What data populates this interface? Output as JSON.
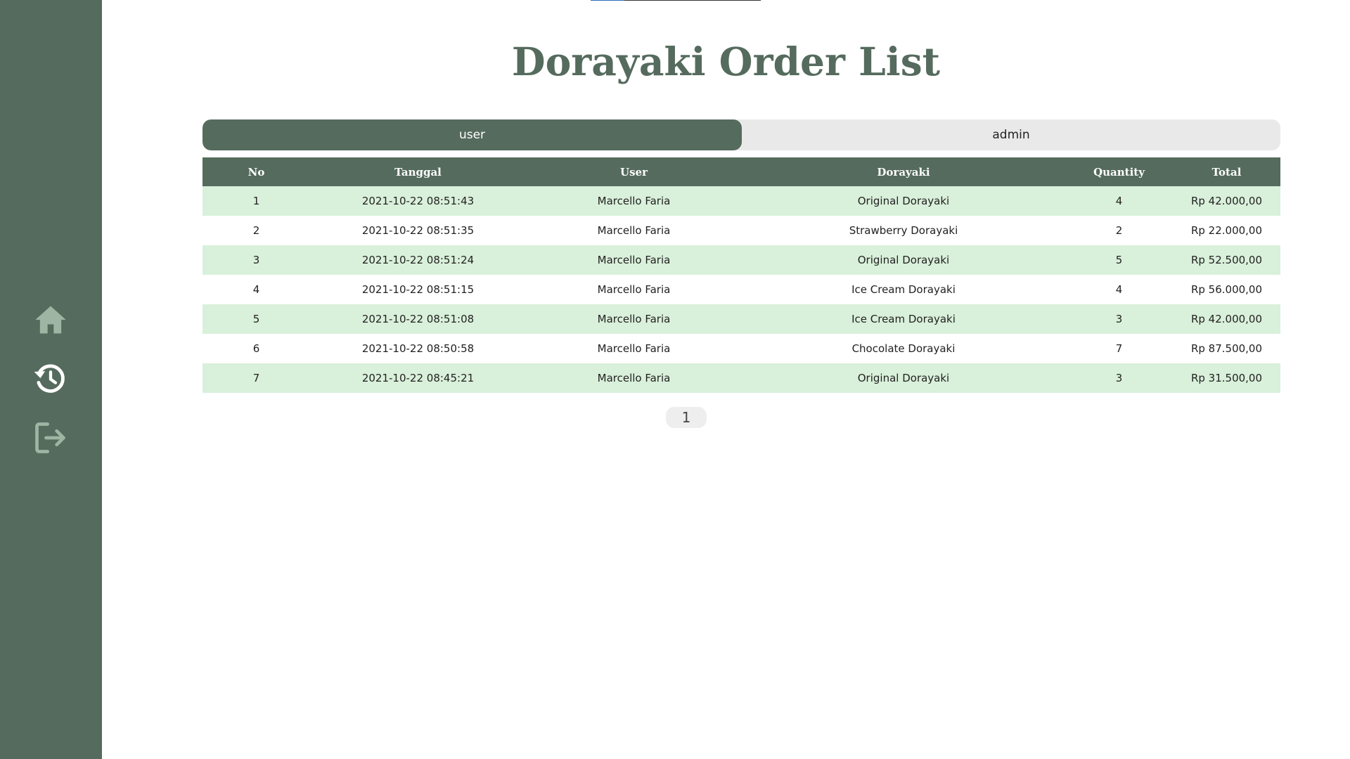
{
  "sidebar": {
    "items": [
      {
        "icon": "home-icon"
      },
      {
        "icon": "history-icon"
      },
      {
        "icon": "logout-icon"
      }
    ]
  },
  "page": {
    "title": "Dorayaki Order List"
  },
  "tabs": {
    "user": "user",
    "admin": "admin",
    "active": "user"
  },
  "table": {
    "headers": [
      "No",
      "Tanggal",
      "User",
      "Dorayaki",
      "Quantity",
      "Total"
    ],
    "rows": [
      [
        "1",
        "2021-10-22 08:51:43",
        "Marcello Faria",
        "Original Dorayaki",
        "4",
        "Rp 42.000,00"
      ],
      [
        "2",
        "2021-10-22 08:51:35",
        "Marcello Faria",
        "Strawberry Dorayaki",
        "2",
        "Rp 22.000,00"
      ],
      [
        "3",
        "2021-10-22 08:51:24",
        "Marcello Faria",
        "Original Dorayaki",
        "5",
        "Rp 52.500,00"
      ],
      [
        "4",
        "2021-10-22 08:51:15",
        "Marcello Faria",
        "Ice Cream Dorayaki",
        "4",
        "Rp 56.000,00"
      ],
      [
        "5",
        "2021-10-22 08:51:08",
        "Marcello Faria",
        "Ice Cream Dorayaki",
        "3",
        "Rp 42.000,00"
      ],
      [
        "6",
        "2021-10-22 08:50:58",
        "Marcello Faria",
        "Chocolate Dorayaki",
        "7",
        "Rp 87.500,00"
      ],
      [
        "7",
        "2021-10-22 08:45:21",
        "Marcello Faria",
        "Original Dorayaki",
        "3",
        "Rp 31.500,00"
      ]
    ]
  },
  "pagination": {
    "current_page": "1"
  },
  "colors": {
    "primary": "#556b5d",
    "row_highlight": "#d9f0da",
    "tab_inactive": "#e9e9e9",
    "icon_muted": "#9db5a2",
    "icon_active": "#ffffff"
  }
}
